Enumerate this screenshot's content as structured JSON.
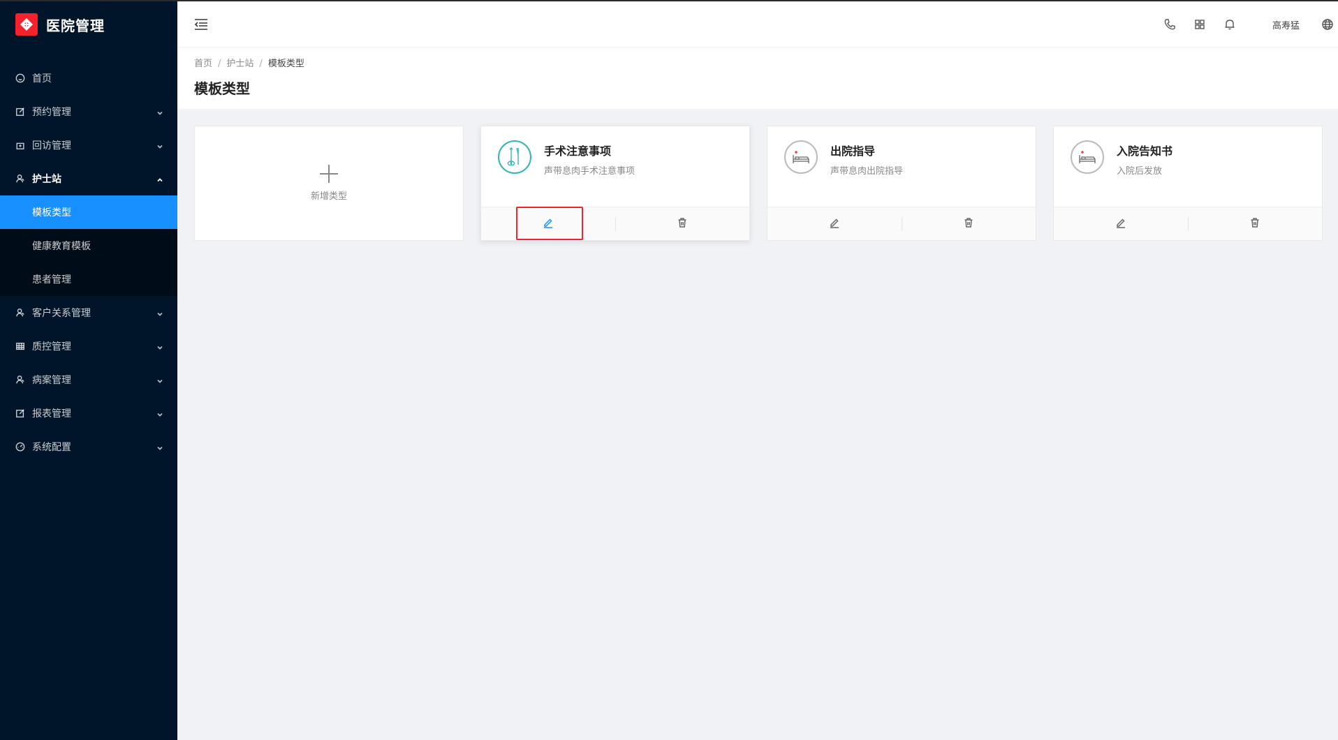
{
  "app": {
    "title": "医院管理",
    "logo_icon": "hospital-logo-icon",
    "brand_color": "#f5222d"
  },
  "sidebar": {
    "items": [
      {
        "label": "首页",
        "icon": "smile-icon",
        "has_arrow": false
      },
      {
        "label": "预约管理",
        "icon": "edit-icon",
        "has_arrow": true
      },
      {
        "label": "回访管理",
        "icon": "lock-icon",
        "has_arrow": true
      },
      {
        "label": "护士站",
        "icon": "user-icon",
        "has_arrow": true,
        "open": true
      },
      {
        "label": "客户关系管理",
        "icon": "user-icon",
        "has_arrow": true
      },
      {
        "label": "质控管理",
        "icon": "table-icon",
        "has_arrow": true
      },
      {
        "label": "病案管理",
        "icon": "user-icon",
        "has_arrow": true
      },
      {
        "label": "报表管理",
        "icon": "edit-icon",
        "has_arrow": true
      },
      {
        "label": "系统配置",
        "icon": "dashboard-icon",
        "has_arrow": true
      }
    ],
    "submenu": [
      {
        "label": "模板类型",
        "active": true
      },
      {
        "label": "健康教育模板",
        "active": false
      },
      {
        "label": "患者管理",
        "active": false
      }
    ],
    "active_color": "#1890ff"
  },
  "header": {
    "user_name": "高寿猛",
    "icons": [
      "phone-icon",
      "apps-icon",
      "bell-icon",
      "globe-icon"
    ]
  },
  "breadcrumb": [
    "首页",
    "护士站",
    "模板类型"
  ],
  "page_title": "模板类型",
  "add_card": {
    "label": "新增类型"
  },
  "cards": [
    {
      "title": "手术注意事项",
      "desc": "声带息肉手术注意事项",
      "icon": "surgery-tools-icon"
    },
    {
      "title": "出院指导",
      "desc": "声带息肉出院指导",
      "icon": "hospital-bed-icon"
    },
    {
      "title": "入院告知书",
      "desc": "入院后发放",
      "icon": "hospital-bed-icon"
    }
  ]
}
